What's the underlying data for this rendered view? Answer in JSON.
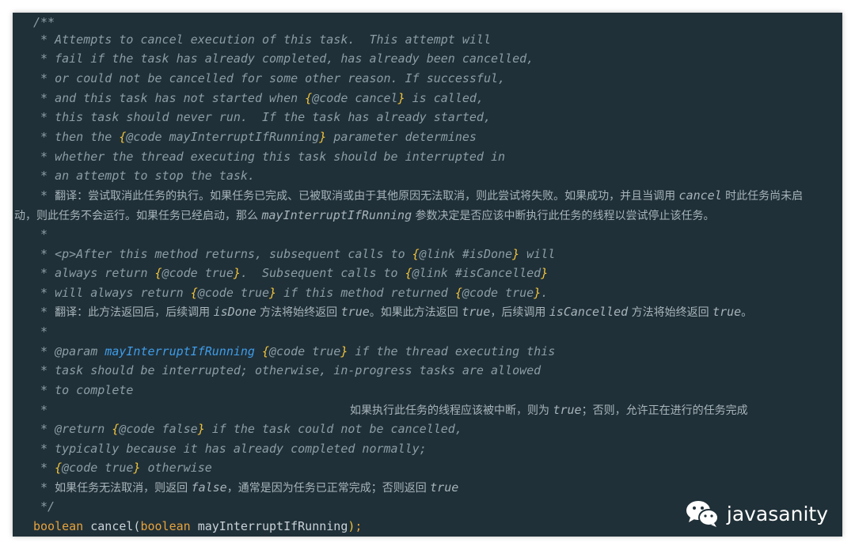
{
  "code": {
    "l1": "/**",
    "l2_star": " * ",
    "l2": "Attempts to cancel execution of this task.  This attempt will",
    "l3": "fail if the task has already completed, has already been cancelled,",
    "l4": "or could not be cancelled for some other reason. If successful,",
    "l5a": "and this task has not started when ",
    "l5b": "{",
    "l5c": "@code cancel",
    "l5d": "}",
    "l5e": " is called,",
    "l6": "this task should never run.  If the task has already started,",
    "l7a": "then the ",
    "l7b": "{",
    "l7c": "@code mayInterruptIfRunning",
    "l7d": "}",
    "l7e": " parameter determines",
    "l8": "whether the thread executing this task should be interrupted in",
    "l9": "an attempt to stop the task.",
    "l10a": "翻译：尝试取消此任务的执行。如果任务已完成、已被取消或由于其他原因无法取消，则此尝试将失败。如果成功，并且当调用 ",
    "l10b": "cancel",
    "l10c": " 时此任务尚未启",
    "l11a": "动，则此任务不会运行。如果任务已经启动，那么 ",
    "l11b": "mayInterruptIfRunning",
    "l11c": " 参数决定是否应该中断执行此任务的线程以尝试停止该任务。",
    "star": " *",
    "l13a": "<p>After this method returns, subsequent calls to ",
    "l13b": "{",
    "l13c": "@link #isDone",
    "l13d": "}",
    "l13e": " will",
    "l14a": "always return ",
    "l14b": "{",
    "l14c": "@code true",
    "l14d": "}",
    "l14e": ".  Subsequent calls to ",
    "l14f": "{",
    "l14g": "@link #isCancelled",
    "l14h": "}",
    "l15a": "will always return ",
    "l15b": "{",
    "l15c": "@code true",
    "l15d": "}",
    "l15e": " if this method returned ",
    "l15f": "{",
    "l15g": "@code true",
    "l15h": "}",
    "l15i": ".",
    "l16a": "翻译：此方法返回后，后续调用 ",
    "l16b": "isDone",
    "l16c": " 方法将始终返回 ",
    "l16d": "true",
    "l16e": "。如果此方法返回 ",
    "l16f": "true",
    "l16g": "，后续调用 ",
    "l16h": "isCancelled",
    "l16i": " 方法将始终返回 ",
    "l16j": "true",
    "l16k": "。",
    "l18a": "@param ",
    "l18b": "mayInterruptIfRunning",
    "l18c": " ",
    "l18d": "{",
    "l18e": "@code true",
    "l18f": "}",
    "l18g": " if the thread executing this",
    "l19": "task should be interrupted; otherwise, in-progress tasks are allowed",
    "l20": "to complete",
    "l21a": "如果执行此任务的线程应该被中断，则为 ",
    "l21b": "true",
    "l21c": "；否则，允许正在进行的任务完成",
    "l22a": "@return ",
    "l22b": "{",
    "l22c": "@code false",
    "l22d": "}",
    "l22e": " if the task could not be cancelled,",
    "l23": "typically because it has already completed normally;",
    "l24a": "{",
    "l24b": "@code true",
    "l24c": "}",
    "l24d": " otherwise",
    "l25a": "如果任务无法取消，则返回 ",
    "l25b": "false",
    "l25c": "，通常是因为任务已正常完成；否则返回 ",
    "l25d": "true",
    "l26": " */",
    "l27a": "boolean",
    "l27b": " cancel(",
    "l27c": "boolean",
    "l27d": " mayInterruptIfRunning",
    "l27e": ")",
    "l27f": ";"
  },
  "watermark": {
    "icon": "wechat-icon",
    "text": "javasanity"
  },
  "colors": {
    "background": "#203038",
    "comment": "#8c9da6",
    "brace": "#f0c33c",
    "keyword": "#e6a23c",
    "param": "#3e9ce8"
  }
}
